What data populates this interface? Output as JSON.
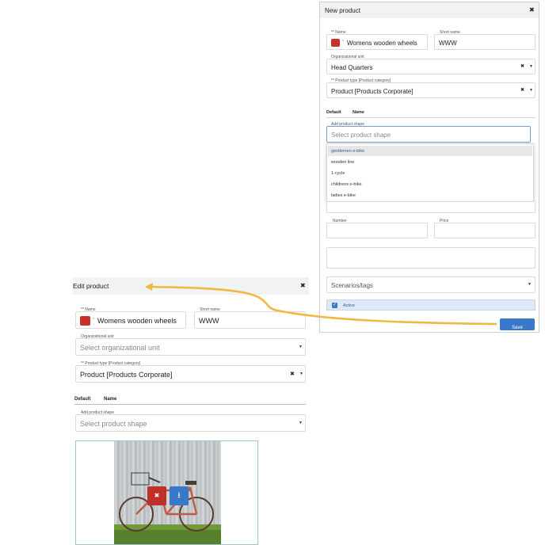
{
  "new_product": {
    "title": "New product",
    "name_label": "** Name",
    "name_value": "Womens wooden wheels",
    "short_name_label": "Short name",
    "short_name_value": "WWW",
    "org_unit_label": "Organizational unit",
    "org_unit_value": "Head Quarters",
    "product_type_label": "** Product type [Product category]",
    "product_type_value": "Product [Products Corporate]",
    "col_default": "Default",
    "col_name": "Name",
    "add_shape_label": "Add product shape",
    "add_shape_placeholder": "Select product shape",
    "shape_options": [
      "gentlemen e-bike",
      "wooden line",
      "1-cycle",
      "childrens e-bike",
      "ladies e-bike"
    ],
    "number_label": "Number",
    "price_label": "Price",
    "scenarios_placeholder": "Scenarios/tags",
    "active_label": "Active",
    "save_label": "Save"
  },
  "edit_product": {
    "title": "Edit product",
    "name_label": "** Name",
    "name_value": "Womens wooden wheels",
    "short_name_label": "Short name",
    "short_name_value": "WWW",
    "org_unit_label": "Organizational unit",
    "org_unit_placeholder": "Select organizational unit",
    "product_type_label": "** Product type [Product category]",
    "product_type_value": "Product [Products Corporate]",
    "col_default": "Default",
    "col_name": "Name",
    "add_shape_label": "Add product shape",
    "add_shape_placeholder": "Select product shape"
  },
  "icons": {
    "close": "✖",
    "clear": "✖",
    "caret": "▼",
    "required": "*",
    "check": "✓",
    "download": "⭳"
  },
  "colors": {
    "accent": "#3a79c9",
    "swatch": "#c8302a",
    "delete_button": "#c0302a",
    "arrow": "#f0b840"
  }
}
